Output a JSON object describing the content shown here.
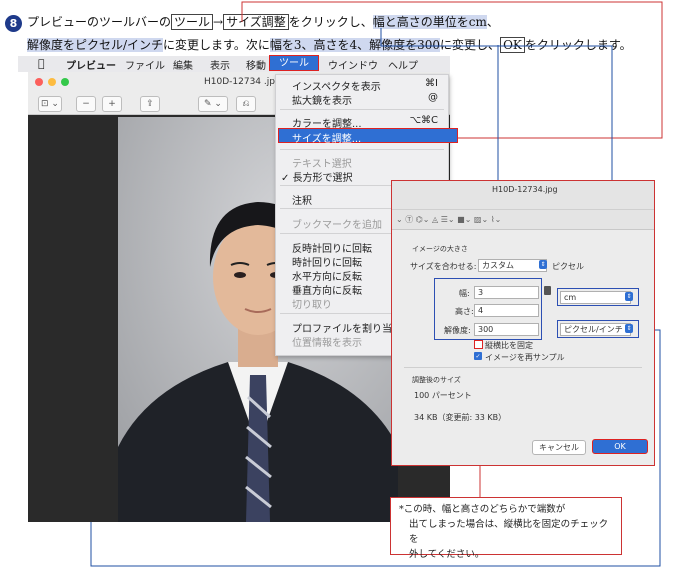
{
  "instruction": {
    "step_number": "8",
    "l1_a": "プレビューのツールバーの",
    "l1_tool": "ツール",
    "l1_arrow": "→",
    "l1_size": "サイズ調整",
    "l1_b": "をクリックし、",
    "l1_hl": "幅と高さの単位をcm",
    "l1_c": "、",
    "l2_hl": "解像度をピクセル/インチ",
    "l2_a": "に変更します。次に",
    "l2_hl2": "幅を3、高さを4、解像度を300",
    "l2_b": "に変更し、",
    "l2_ok": "OK",
    "l2_c": "をクリックします。"
  },
  "menubar": {
    "apple": "",
    "items": [
      "プレビュー",
      "ファイル",
      "編集",
      "表示",
      "移動",
      "ツール",
      "ウインドウ",
      "ヘルプ"
    ]
  },
  "window": {
    "title": "H10D-12734 .jp",
    "toolbar_buttons": [
      "⊡ ⌄",
      "−",
      "+",
      "⇪",
      "✎ ⌄",
      "⎌"
    ]
  },
  "tools_menu": {
    "items": [
      {
        "label": "インスペクタを表示",
        "shortcut": "⌘I"
      },
      {
        "label": "拡大鏡を表示",
        "shortcut": "@"
      },
      {
        "label": "カラーを調整...",
        "shortcut": "⌥⌘C"
      },
      {
        "label": "サイズを調整...",
        "shortcut": ""
      },
      {
        "label": "テキスト選択",
        "shortcut": ""
      },
      {
        "label": "✓ 長方形で選択",
        "shortcut": ""
      },
      {
        "label": "注釈",
        "shortcut": ""
      },
      {
        "label": "ブックマークを追加",
        "shortcut": ""
      },
      {
        "label": "反時計回りに回転",
        "shortcut": ""
      },
      {
        "label": "時計回りに回転",
        "shortcut": ""
      },
      {
        "label": "水平方向に反転",
        "shortcut": ""
      },
      {
        "label": "垂直方向に反転",
        "shortcut": ""
      },
      {
        "label": "切り取り",
        "shortcut": ""
      },
      {
        "label": "プロファイルを割り当",
        "shortcut": ""
      },
      {
        "label": "位置情報を表示",
        "shortcut": ""
      }
    ]
  },
  "size_dialog": {
    "window_title": "H10D-12734.jpg",
    "section_title": "イメージの大きさ",
    "fit_label": "サイズを合わせる:",
    "fit_value": "カスタム",
    "fit_unit": "ピクセル",
    "width_label": "幅:",
    "width_value": "3",
    "height_label": "高さ:",
    "height_value": "4",
    "resolution_label": "解像度:",
    "resolution_value": "300",
    "unit_value": "cm",
    "res_unit_value": "ピクセル/インチ",
    "keep_ratio_label": "縦横比を固定",
    "resample_label": "イメージを再サンプル",
    "result_title": "調整後のサイズ",
    "result_percent": "100 パーセント",
    "result_size": "34 KB（変更前: 33 KB）",
    "cancel_label": "キャンセル",
    "ok_label": "OK"
  },
  "note": {
    "line1": "*この時、幅と高さのどちらかで端数が",
    "line2": "出てしまった場合は、縦横比を固定のチェックを",
    "line3": "外してください。"
  }
}
